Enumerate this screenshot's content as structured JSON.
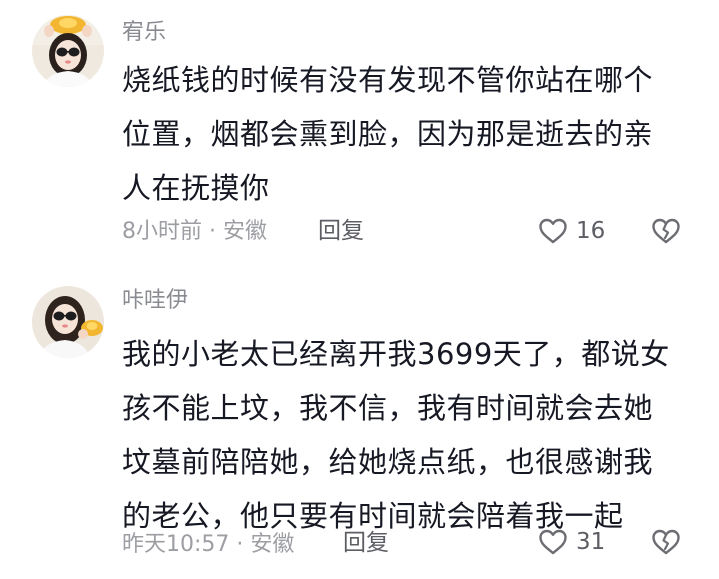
{
  "comments": [
    {
      "username": "宥乐",
      "text_lines": [
        "烧纸钱的时候有没有发现不管你站在哪个",
        "位置，烟都会熏到脸，因为那是逝去的亲",
        "人在抚摸你"
      ],
      "meta": "8小时前 · 安徽",
      "reply_label": "回复",
      "like_count": "16",
      "avatar_icon": "avatar-girl-sunglasses-gold-ingot"
    },
    {
      "username": "咔哇伊",
      "text_lines": [
        "我的小老太已经离开我3699天了，都说女",
        "孩不能上坟，我不信，我有时间就会去她",
        "坟墓前陪陪她，给她烧点纸，也很感谢我",
        "的老公，他只要有时间就会陪着我一起"
      ],
      "meta": "昨天10:57 · 安徽",
      "reply_label": "回复",
      "like_count": "31",
      "avatar_icon": "avatar-girl-sunglasses-gold-ingot"
    }
  ],
  "icons": {
    "like": "heart-outline-icon",
    "dislike": "broken-heart-outline-icon"
  },
  "colors": {
    "text": "#161823",
    "username": "#8a8b91",
    "meta": "#9d9ea3",
    "action": "#5d5e64",
    "icon": "#6c6d72"
  }
}
